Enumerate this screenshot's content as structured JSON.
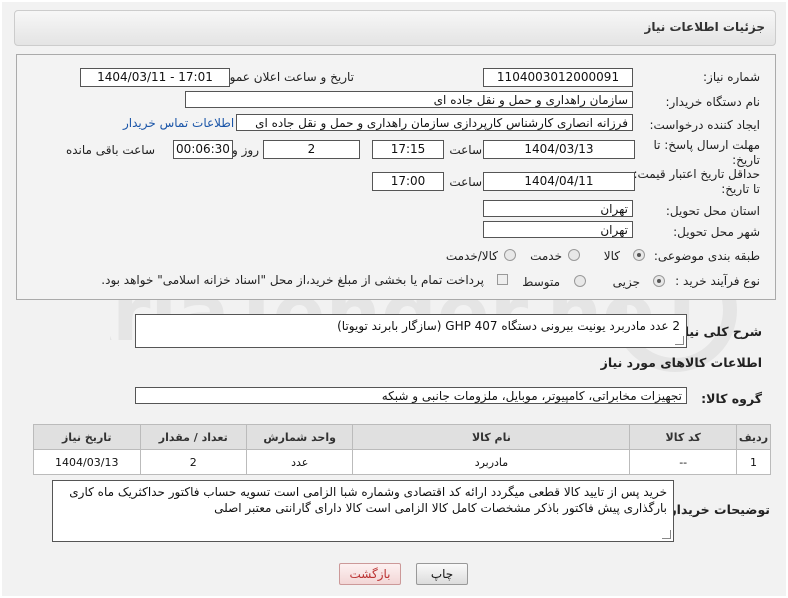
{
  "header": {
    "title": "جزئیات اطلاعات نیاز"
  },
  "form": {
    "need_number_label": "شماره نیاز:",
    "need_number": "1104003012000091",
    "announce_label": "تاریخ و ساعت اعلان عمومی:",
    "announce_value": "1404/03/11 - 17:01",
    "buyer_org_label": "نام دستگاه خریدار:",
    "buyer_org": "سازمان راهداری و حمل و نقل جاده ای",
    "creator_label": "ایجاد کننده درخواست:",
    "creator": "فرزانه انصاری کارشناس کارپردازی سازمان راهداری و حمل و نقل جاده ای",
    "contact_link": "اطلاعات تماس خریدار",
    "deadline_label": "مهلت ارسال پاسخ: تا تاریخ:",
    "deadline_date": "1404/03/13",
    "time_label": "ساعت",
    "deadline_time": "17:15",
    "days_value": "2",
    "days_label": "روز و",
    "remaining_time": "00:06:30",
    "remaining_label": "ساعت باقی مانده",
    "validity_label": "حداقل تاریخ اعتبار قیمت: تا تاریخ:",
    "validity_date": "1404/04/11",
    "validity_time_label": "ساعت",
    "validity_time": "17:00",
    "province_label": "استان محل تحویل:",
    "province": "تهران",
    "city_label": "شهر محل تحویل:",
    "city": "تهران",
    "category_label": "طبقه بندی موضوعی:",
    "category_options": [
      "کالا",
      "خدمت",
      "کالا/خدمت"
    ],
    "process_label": "نوع فرآیند خرید :",
    "process_options": [
      "جزیی",
      "متوسط"
    ],
    "payment_note": "پرداخت تمام یا بخشی از مبلغ خرید،از محل \"اسناد خزانه اسلامی\" خواهد بود."
  },
  "summary": {
    "label": "شرح کلی نیاز:",
    "text": "2 عدد مادربرد یونیت بیرونی دستگاه GHP 407 (سازگار بابرند تویوتا)"
  },
  "goods": {
    "section_title": "اطلاعات کالاهای مورد نیاز",
    "group_label": "گروه کالا:",
    "group_value": "تجهیزات مخابراتی، کامپیوتر، موبایل، ملزومات جانبی و شبکه",
    "columns": [
      "ردیف",
      "کد کالا",
      "نام کالا",
      "واحد شمارش",
      "تعداد / مقدار",
      "تاریخ نیاز"
    ],
    "rows": [
      [
        "1",
        "--",
        "مادربرد",
        "عدد",
        "2",
        "1404/03/13"
      ]
    ]
  },
  "buyer_notes": {
    "label": "توضیحات خریدار:",
    "text": "خرید پس از تایید کالا قطعی میگردد ارائه کد اقتصادی وشماره شبا الزامی است تسویه حساب فاکتور حداکثریک ماه کاری بارگذاری پیش فاکتور باذکر مشخصات کامل کالا الزامی است کالا دارای گارانتی معتبر اصلی"
  },
  "buttons": {
    "print": "چاپ",
    "back": "بازگشت"
  },
  "watermark": {
    "text": "AriaTender.neT"
  }
}
